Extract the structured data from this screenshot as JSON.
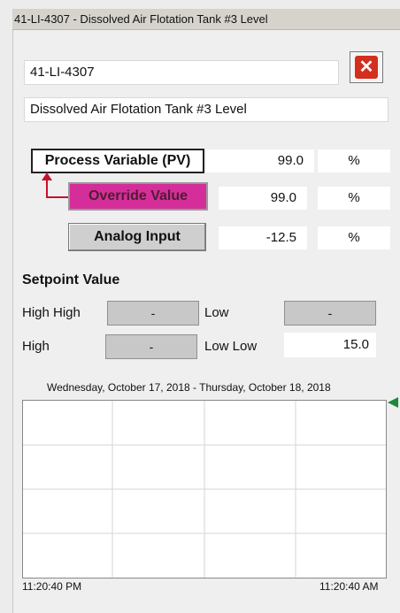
{
  "window": {
    "title": "41-LI-4307 - Dissolved Air Flotation Tank #3 Level"
  },
  "tag": {
    "name": "41-LI-4307",
    "description": "Dissolved Air Flotation Tank #3 Level"
  },
  "process": {
    "pv_label": "Process Variable (PV)",
    "pv_value": "99.0",
    "pv_unit": "%",
    "override_label": "Override Value",
    "override_value": "99.0",
    "override_unit": "%",
    "analog_label": "Analog Input",
    "analog_value": "-12.5",
    "analog_unit": "%",
    "override_color": "#d52e9b"
  },
  "setpoints": {
    "section_title": "Setpoint Value",
    "high_high_label": "High High",
    "high_high_value": "-",
    "low_label": "Low",
    "low_value": "-",
    "high_label": "High",
    "high_value": "-",
    "low_low_label": "Low Low",
    "low_low_value": "15.0"
  },
  "trend": {
    "date_range": "Wednesday, October 17, 2018 - Thursday, October 18, 2018",
    "start_time": "11:20:40 PM",
    "end_time": "11:20:40 AM",
    "marker_color": "#1a8a3a"
  },
  "icons": {
    "close": "close-icon",
    "arrow": "bent-arrow-icon",
    "marker": "triangle-left-icon"
  }
}
